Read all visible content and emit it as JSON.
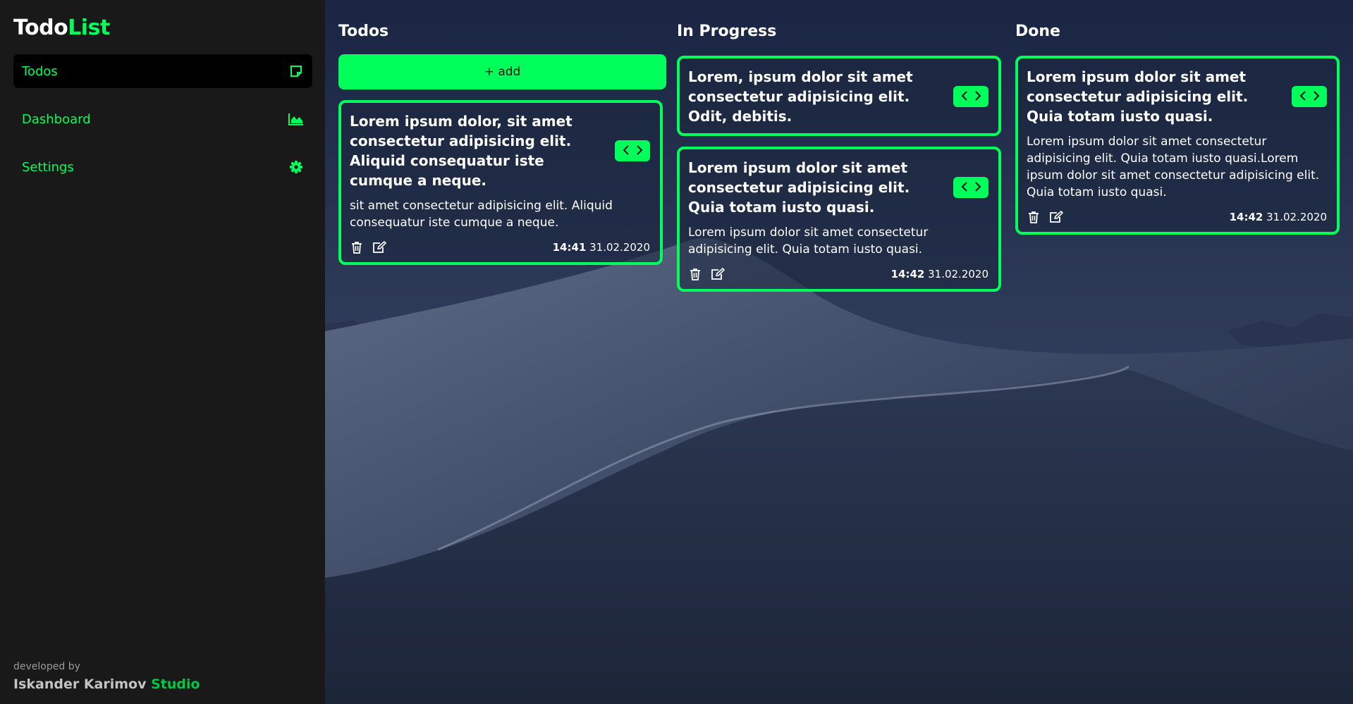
{
  "brand": {
    "part1": "Todo",
    "part2": "List"
  },
  "nav": [
    {
      "label": "Todos",
      "icon": "sticky-note-icon",
      "active": true
    },
    {
      "label": "Dashboard",
      "icon": "area-chart-icon",
      "active": false
    },
    {
      "label": "Settings",
      "icon": "gear-icon",
      "active": false
    }
  ],
  "footer": {
    "developed_by": "developed by",
    "author": "Iskander Karimov",
    "studio": "Studio"
  },
  "colors": {
    "accent": "#00ff5a",
    "sidebar": "#191919",
    "active_nav": "#000000"
  },
  "columns": {
    "todos": {
      "title": "Todos",
      "add_label": "+ add",
      "cards": [
        {
          "title": "Lorem ipsum dolor, sit amet consectetur adipisicing elit. Aliquid consequatur iste cumque a neque.",
          "body": "sit amet consectetur adipisicing elit. Aliquid consequatur iste cumque a neque.",
          "time": "14:41",
          "date": "31.02.2020"
        }
      ]
    },
    "in_progress": {
      "title": "In Progress",
      "cards": [
        {
          "title": "Lorem, ipsum dolor sit amet consectetur adipisicing elit. Odit, debitis.",
          "body": "",
          "time": "",
          "date": ""
        },
        {
          "title": "Lorem ipsum dolor sit amet consectetur adipisicing elit. Quia totam iusto quasi.",
          "body": "Lorem ipsum dolor sit amet consectetur adipisicing elit. Quia totam iusto quasi.",
          "time": "14:42",
          "date": "31.02.2020"
        }
      ]
    },
    "done": {
      "title": "Done",
      "cards": [
        {
          "title": "Lorem ipsum dolor sit amet consectetur adipisicing elit. Quia totam iusto quasi.",
          "body": "Lorem ipsum dolor sit amet consectetur adipisicing elit. Quia totam iusto quasi.Lorem ipsum dolor sit amet consectetur adipisicing elit. Quia totam iusto quasi.",
          "time": "14:42",
          "date": "31.02.2020"
        }
      ]
    }
  }
}
